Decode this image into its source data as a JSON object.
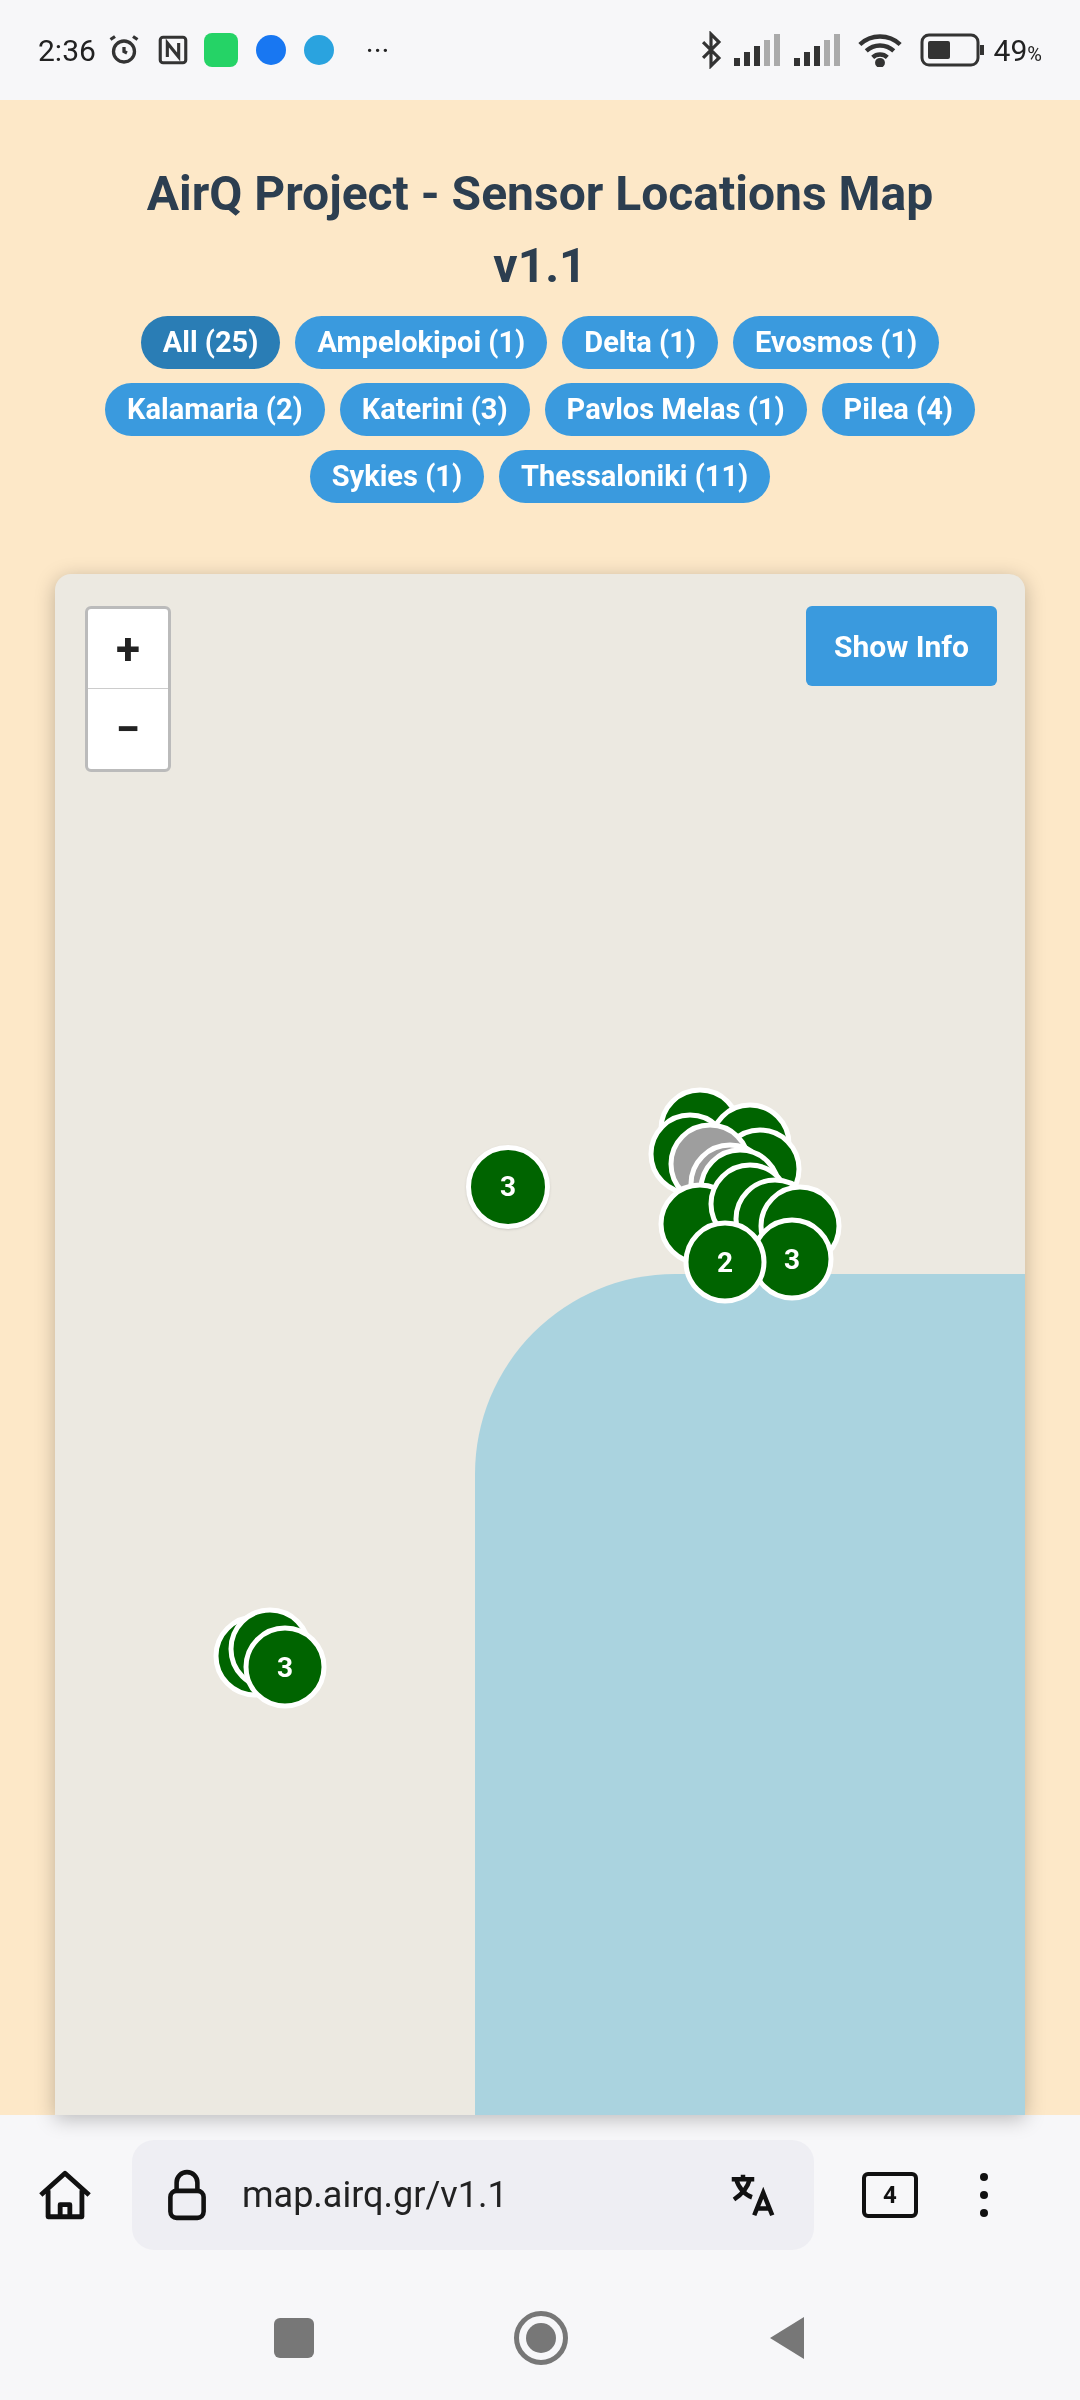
{
  "status_bar": {
    "time": "2:36",
    "more": "···",
    "battery": "49",
    "battery_unit": "%"
  },
  "title": "AirQ Project - Sensor Locations Map v1.1",
  "filters": [
    {
      "label": "All (25)",
      "selected": true
    },
    {
      "label": "Ampelokipoi (1)",
      "selected": false
    },
    {
      "label": "Delta (1)",
      "selected": false
    },
    {
      "label": "Evosmos (1)",
      "selected": false
    },
    {
      "label": "Kalamaria (2)",
      "selected": false
    },
    {
      "label": "Katerini (3)",
      "selected": false
    },
    {
      "label": "Pavlos Melas (1)",
      "selected": false
    },
    {
      "label": "Pilea (4)",
      "selected": false
    },
    {
      "label": "Sykies (1)",
      "selected": false
    },
    {
      "label": "Thessaloniki (11)",
      "selected": false
    }
  ],
  "map": {
    "zoom_in": "+",
    "zoom_out": "−",
    "info_button": "Show Info",
    "markers": [
      {
        "label": "3"
      },
      {
        "label": "2"
      },
      {
        "label": "3"
      },
      {
        "label": "3"
      }
    ]
  },
  "browser": {
    "url": "map.airq.gr/v1.1",
    "tabs": "4"
  }
}
